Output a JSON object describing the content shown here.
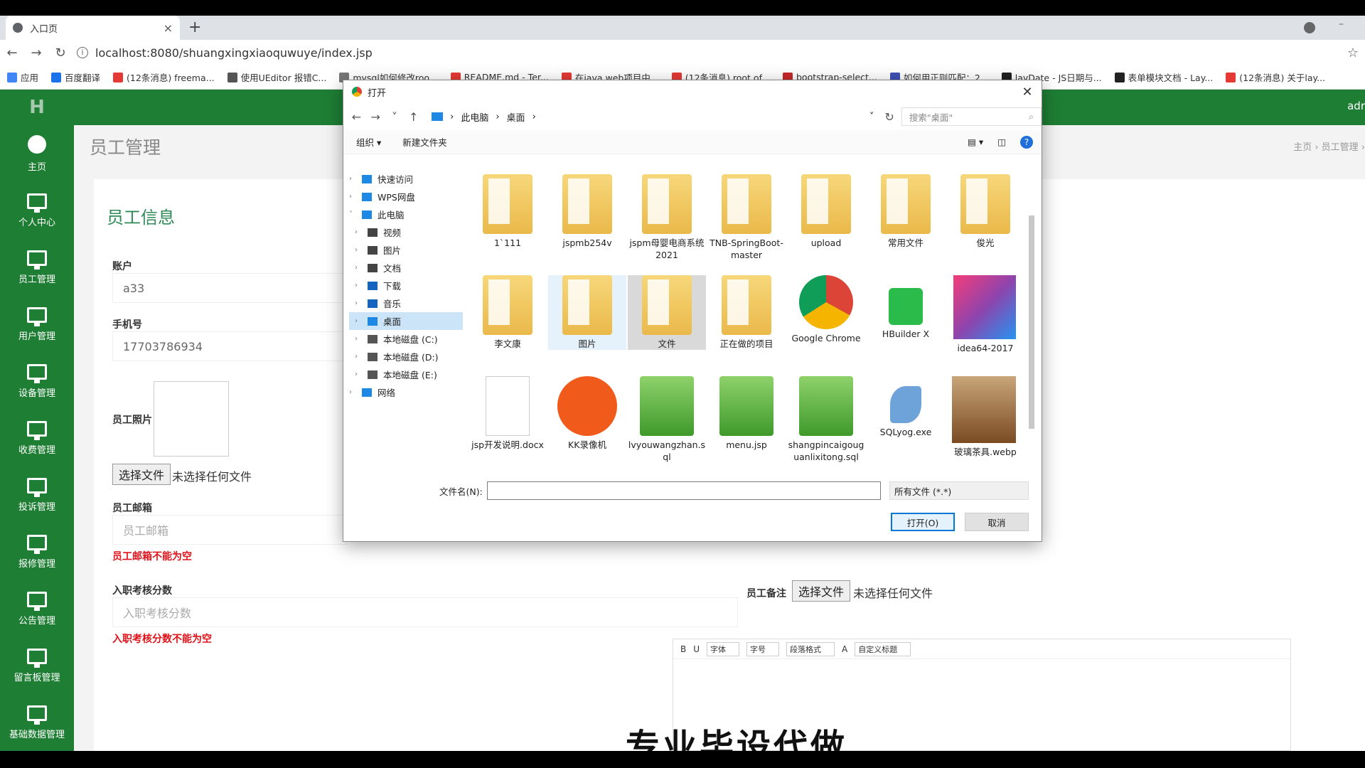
{
  "browser": {
    "tab_title": "入口页",
    "url": "localhost:8080/shuangxingxiaoquwuye/index.jsp",
    "bookmarks": [
      "应用",
      "百度翻译",
      "(12条消息) freema...",
      "使用UEditor 报错C...",
      "mysql如何修改roo...",
      "README.md - Ter...",
      "在java web项目中...",
      "(12条消息) root of...",
      "bootstrap-select...",
      "如何用正则匹配：2...",
      "layDate - JS日期与...",
      "表单模块文档 - Lay...",
      "(12条消息) 关于lay..."
    ]
  },
  "app": {
    "logo": "H",
    "admin": "adr",
    "sidebar": [
      "主页",
      "个人中心",
      "员工管理",
      "用户管理",
      "设备管理",
      "收费管理",
      "投诉管理",
      "报修管理",
      "公告管理",
      "留言板管理",
      "基础数据管理"
    ],
    "page_title": "员工管理",
    "crumbs": "主页 › 员工管理 ›",
    "panel_title": "员工信息",
    "labels": {
      "account": "账户",
      "phone": "手机号",
      "photo": "员工照片",
      "email": "员工邮箱",
      "score": "入职考核分数",
      "remark": "员工备注"
    },
    "values": {
      "account": "a33",
      "phone": "17703786934"
    },
    "placeholders": {
      "email": "员工邮箱",
      "score": "入职考核分数"
    },
    "errors": {
      "email": "员工邮箱不能为空",
      "score": "入职考核分数不能为空"
    },
    "file_button": "选择文件",
    "file_none": "未选择任何文件",
    "editor_toolbar": [
      "B",
      "U",
      "字体",
      "字号",
      "段落格式",
      "A",
      "自定义标题"
    ]
  },
  "overlay_text": "专业毕设代做",
  "dialog": {
    "title": "打开",
    "path": [
      "此电脑",
      "桌面"
    ],
    "search_placeholder": "搜索\"桌面\"",
    "organize": "组织 ▾",
    "new_folder": "新建文件夹",
    "tree": [
      {
        "label": "快速访问",
        "level": 0
      },
      {
        "label": "WPS网盘",
        "level": 0
      },
      {
        "label": "此电脑",
        "level": 0
      },
      {
        "label": "视频",
        "level": 1
      },
      {
        "label": "图片",
        "level": 1
      },
      {
        "label": "文档",
        "level": 1
      },
      {
        "label": "下载",
        "level": 1
      },
      {
        "label": "音乐",
        "level": 1
      },
      {
        "label": "桌面",
        "level": 1
      },
      {
        "label": "本地磁盘 (C:)",
        "level": 1
      },
      {
        "label": "本地磁盘 (D:)",
        "level": 1
      },
      {
        "label": "本地磁盘 (E:)",
        "level": 1
      },
      {
        "label": "网络",
        "level": 0
      }
    ],
    "files": [
      {
        "name": "1`111",
        "kind": "folder"
      },
      {
        "name": "jspmb254v",
        "kind": "folder"
      },
      {
        "name": "jspm母婴电商系统2021",
        "kind": "folder"
      },
      {
        "name": "TNB-SpringBoot-master",
        "kind": "folder"
      },
      {
        "name": "upload",
        "kind": "folder"
      },
      {
        "name": "常用文件",
        "kind": "folder"
      },
      {
        "name": "俊光",
        "kind": "folder"
      },
      {
        "name": "李文康",
        "kind": "folder"
      },
      {
        "name": "图片",
        "kind": "folder"
      },
      {
        "name": "文件",
        "kind": "folder"
      },
      {
        "name": "正在做的项目",
        "kind": "folder"
      },
      {
        "name": "Google Chrome",
        "kind": "chrome"
      },
      {
        "name": "HBuilder X",
        "kind": "hbuilder"
      },
      {
        "name": "idea64-2017",
        "kind": "idea"
      },
      {
        "name": "jsp开发说明.docx",
        "kind": "doc"
      },
      {
        "name": "KK录像机",
        "kind": "kk"
      },
      {
        "name": "lvyouwangzhan.sql",
        "kind": "sql"
      },
      {
        "name": "menu.jsp",
        "kind": "sql"
      },
      {
        "name": "shangpincaigouguanlixitong.sql",
        "kind": "sql"
      },
      {
        "name": "SQLyog.exe",
        "kind": "sqlyog"
      },
      {
        "name": "玻璃茶具.webp",
        "kind": "image"
      }
    ],
    "filename_label": "文件名(N):",
    "filetype": "所有文件 (*.*)",
    "open_button": "打开(O)",
    "cancel_button": "取消"
  }
}
